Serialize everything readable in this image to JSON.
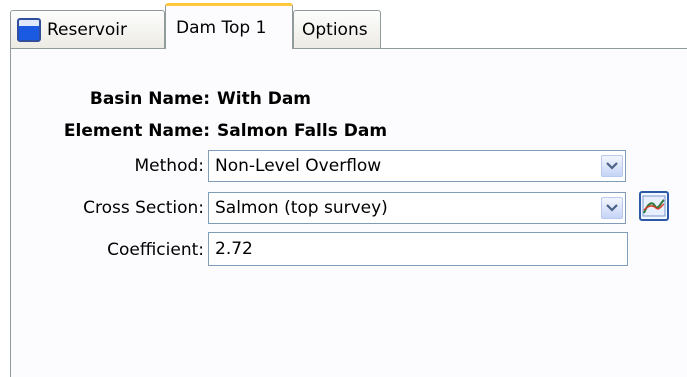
{
  "tabs": [
    {
      "label": "Reservoir",
      "icon": "reservoir-icon",
      "active": false
    },
    {
      "label": "Dam Top 1",
      "active": true
    },
    {
      "label": "Options",
      "active": false
    }
  ],
  "info": {
    "basin_label": "Basin Name:",
    "basin_value": "With Dam",
    "element_label": "Element Name:",
    "element_value": "Salmon Falls Dam"
  },
  "fields": {
    "method_label": "Method:",
    "method_value": "Non-Level Overflow",
    "cross_section_label": "Cross Section:",
    "cross_section_value": "Salmon (top survey)",
    "coefficient_label": "Coefficient:",
    "coefficient_value": "2.72"
  },
  "colors": {
    "active_tab_accent": "#ffc83c",
    "border": "#919b9c",
    "field_border": "#7f9db9",
    "icon_blue": "#1a5ae2"
  }
}
